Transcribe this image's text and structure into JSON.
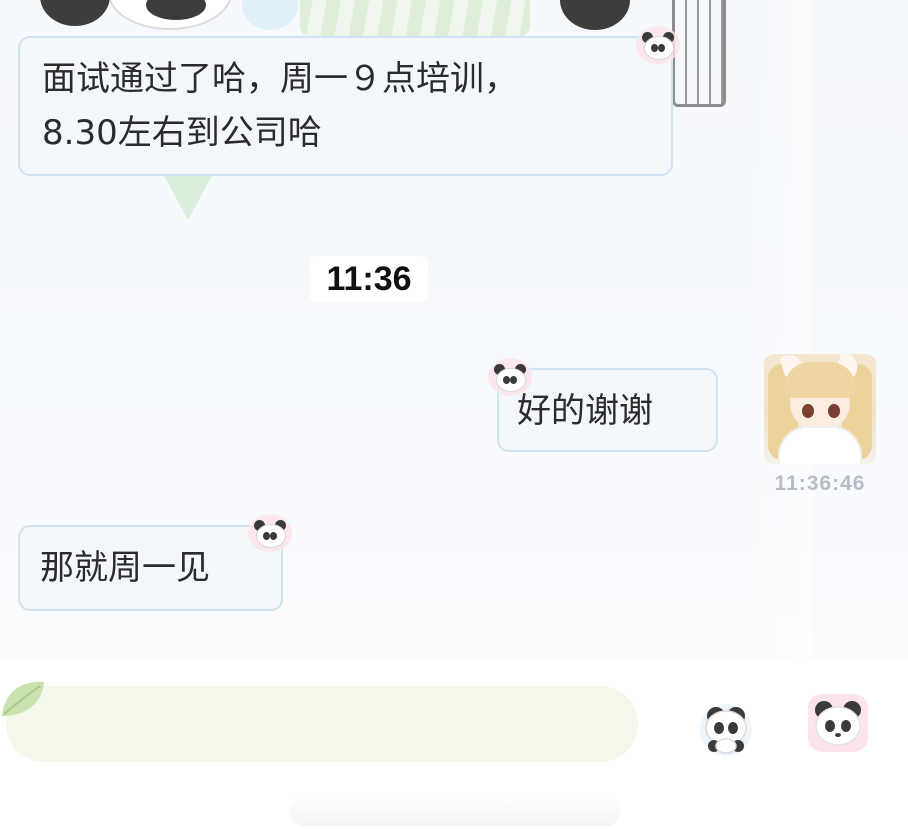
{
  "conversation": {
    "messages": [
      {
        "side": "left",
        "lines": [
          "面试通过了哈，周一９点培训，",
          "8.30左右到公司哈"
        ]
      },
      {
        "side": "right",
        "text": "好的谢谢",
        "sent_time": "11:36:46"
      },
      {
        "side": "left",
        "text": "那就周一见"
      }
    ],
    "time_divider": "11:36"
  },
  "input": {
    "placeholder": ""
  },
  "icons": {
    "sticker": "panda-sticker-icon",
    "emoji": "panda-emoji-icon",
    "leaf": "leaf-icon"
  },
  "colors": {
    "bubble_fill": "#f3f6fb",
    "bubble_border": "#cfe3f3",
    "input_fill": "#f3f8ea",
    "timestamp_text": "#b7bcc3"
  }
}
